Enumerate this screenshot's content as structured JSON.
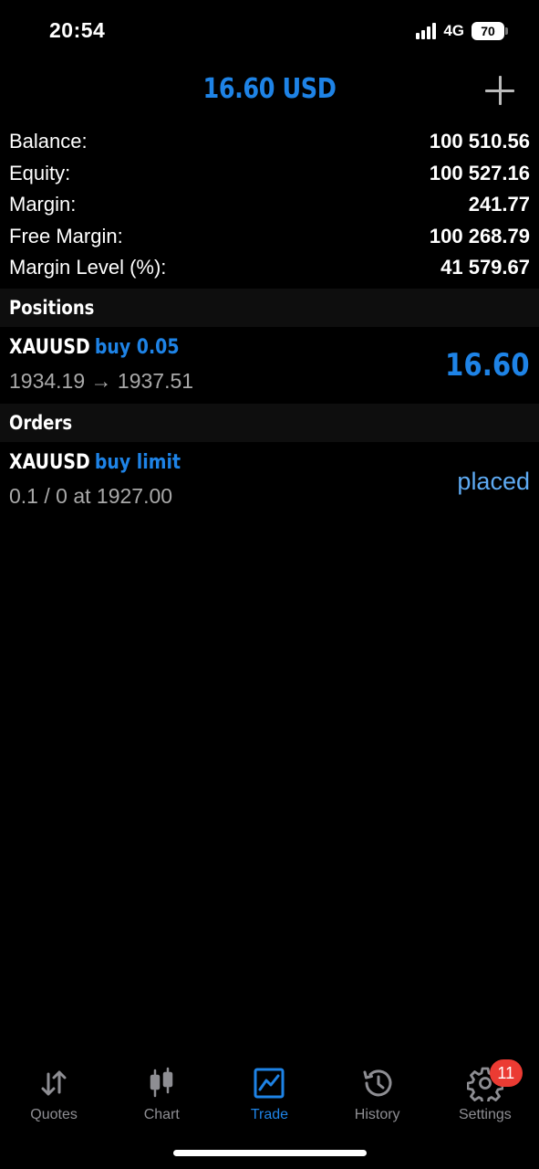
{
  "status_bar": {
    "time": "20:54",
    "network": "4G",
    "battery": "70"
  },
  "header": {
    "title": "16.60 USD"
  },
  "summary": [
    {
      "label": "Balance:",
      "value": "100 510.56"
    },
    {
      "label": "Equity:",
      "value": "100 527.16"
    },
    {
      "label": "Margin:",
      "value": "241.77"
    },
    {
      "label": "Free Margin:",
      "value": "100 268.79"
    },
    {
      "label": "Margin Level (%):",
      "value": "41 579.67"
    }
  ],
  "positions": {
    "title": "Positions",
    "items": [
      {
        "symbol": "XAUUSD",
        "type": "buy 0.05",
        "detail": "1934.19 → 1937.51",
        "profit": "16.60"
      }
    ]
  },
  "orders": {
    "title": "Orders",
    "items": [
      {
        "symbol": "XAUUSD",
        "type": "buy limit",
        "detail": "0.1 / 0 at 1927.00",
        "status": "placed"
      }
    ]
  },
  "tabs": [
    {
      "label": "Quotes",
      "icon": "quotes-arrows-icon"
    },
    {
      "label": "Chart",
      "icon": "candlestick-chart-icon"
    },
    {
      "label": "Trade",
      "icon": "trade-chart-icon",
      "active": true
    },
    {
      "label": "History",
      "icon": "history-clock-icon"
    },
    {
      "label": "Settings",
      "icon": "gear-icon",
      "badge": "11"
    }
  ],
  "colors": {
    "accent": "#1e83e6",
    "badge": "#eb3b33",
    "inactive_tab": "#8e8e93"
  }
}
